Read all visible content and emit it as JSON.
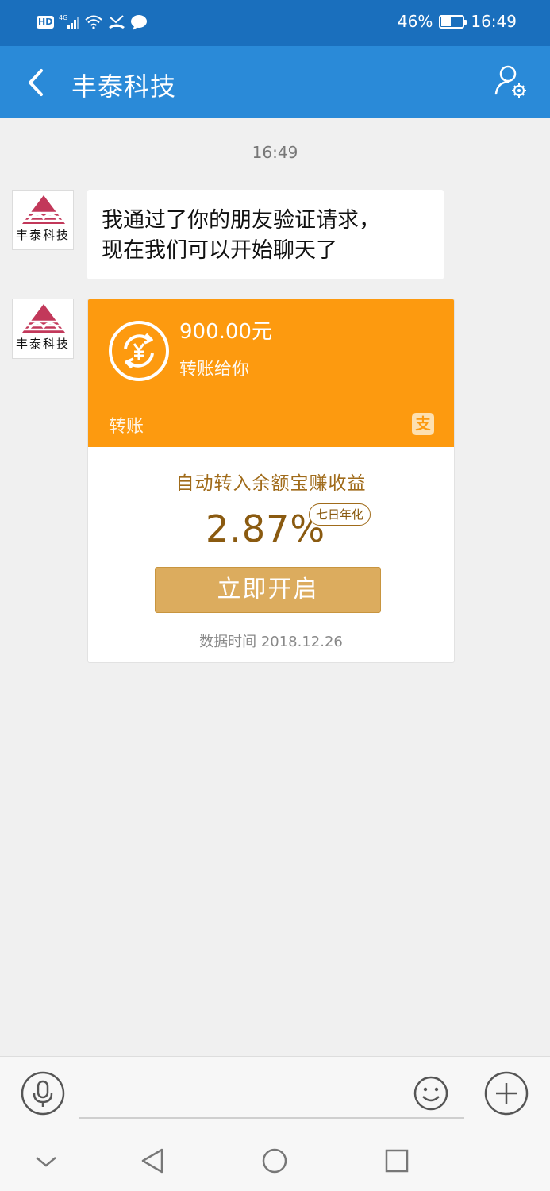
{
  "status_bar": {
    "hd": "HD",
    "network": "4G",
    "battery": "46%",
    "battery_level": 0.46,
    "time": "16:49"
  },
  "header": {
    "title": "丰泰科技",
    "icons": {
      "back": "back-arrow-icon",
      "profile": "profile-settings-icon"
    }
  },
  "chat": {
    "timestamp": "16:49",
    "sender": {
      "avatar_text": "丰泰科技"
    },
    "messages": [
      {
        "type": "text",
        "lines": [
          "我通过了你的朋友验证请求，",
          "现在我们可以开始聊天了"
        ]
      },
      {
        "type": "transfer",
        "amount": "900.00元",
        "subtitle": "转账给你",
        "label": "转账",
        "alipay_glyph": "支",
        "promo": "自动转入余额宝赚收益",
        "rate": "2.87%",
        "rate_badge": "七日年化",
        "button": "立即开启",
        "data_time": "数据时间 2018.12.26"
      }
    ]
  },
  "input_bar": {
    "placeholder": "",
    "icons": {
      "voice": "microphone-icon",
      "emoji": "emoji-icon",
      "more": "plus-icon"
    }
  },
  "nav_bar": {
    "icons": [
      "collapse-chevron-icon",
      "back-triangle-icon",
      "home-circle-icon",
      "recents-square-icon"
    ]
  },
  "colors": {
    "status_bar": "#1a6fbd",
    "title_bar": "#2a8ad8",
    "transfer_orange": "#fd9a0f",
    "button_gold": "#dcac5e",
    "rate_brown": "#8a5a10"
  }
}
